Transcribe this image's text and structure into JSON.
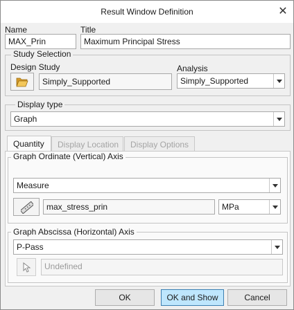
{
  "window": {
    "title": "Result Window Definition"
  },
  "name": {
    "label": "Name",
    "value": "MAX_Prin"
  },
  "title_field": {
    "label": "Title",
    "value": "Maximum Principal Stress"
  },
  "study_selection": {
    "label": "Study Selection",
    "design_study_label": "Design Study",
    "design_study_value": "Simply_Supported",
    "analysis_label": "Analysis",
    "analysis_value": "Simply_Supported"
  },
  "display_type": {
    "label": "Display type",
    "value": "Graph"
  },
  "tabs": [
    {
      "label": "Quantity",
      "active": true
    },
    {
      "label": "Display Location",
      "active": false
    },
    {
      "label": "Display Options",
      "active": false
    }
  ],
  "ordinate": {
    "label": "Graph Ordinate (Vertical) Axis",
    "type_value": "Measure",
    "measure_value": "max_stress_prin",
    "units_value": "MPa"
  },
  "abscissa": {
    "label": "Graph Abscissa (Horizontal) Axis",
    "type_value": "P-Pass",
    "undefined_value": "Undefined"
  },
  "buttons": {
    "ok": "OK",
    "ok_and_show": "OK and Show",
    "cancel": "Cancel"
  },
  "icons": {
    "close": "close-icon",
    "folder": "folder-open-icon",
    "measure": "ruler-icon",
    "pointer": "arrow-cursor-icon"
  },
  "colors": {
    "primary_button": "#bee6fd",
    "primary_border": "#3c7fb1",
    "folder": "#e8b74a"
  }
}
